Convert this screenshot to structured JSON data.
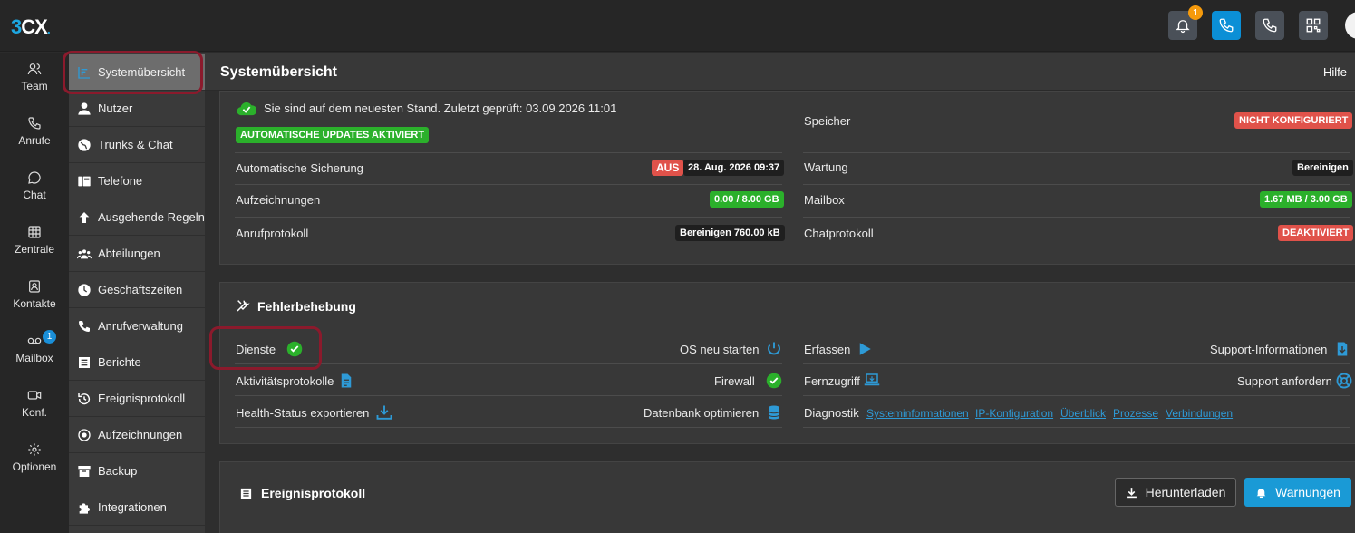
{
  "app": {
    "logo_a": "3",
    "logo_b": "CX",
    "logo_dot": "."
  },
  "topbar": {
    "notification_count": "1"
  },
  "rail": [
    {
      "label": "Team",
      "icon": "team-icon"
    },
    {
      "label": "Anrufe",
      "icon": "phone-icon"
    },
    {
      "label": "Chat",
      "icon": "chat-icon"
    },
    {
      "label": "Zentrale",
      "icon": "grid-icon"
    },
    {
      "label": "Kontakte",
      "icon": "contacts-icon"
    },
    {
      "label": "Mailbox",
      "icon": "voicemail-icon",
      "badge": "1"
    },
    {
      "label": "Konf.",
      "icon": "video-icon"
    },
    {
      "label": "Optionen",
      "icon": "gear-icon"
    }
  ],
  "subnav": [
    {
      "label": "Systemübersicht"
    },
    {
      "label": "Nutzer"
    },
    {
      "label": "Trunks & Chat"
    },
    {
      "label": "Telefone"
    },
    {
      "label": "Ausgehende Regeln"
    },
    {
      "label": "Abteilungen"
    },
    {
      "label": "Geschäftszeiten"
    },
    {
      "label": "Anrufverwaltung"
    },
    {
      "label": "Berichte"
    },
    {
      "label": "Ereignisprotokoll"
    },
    {
      "label": "Aufzeichnungen"
    },
    {
      "label": "Backup"
    },
    {
      "label": "Integrationen"
    }
  ],
  "page": {
    "title": "Systemübersicht",
    "help": "Hilfe"
  },
  "status": {
    "update_msg": "Sie sind auf dem neuesten Stand. Zuletzt geprüft: 03.09.2026 11:01",
    "auto_updates": "AUTOMATISCHE UPDATES AKTIVIERT",
    "backup_label": "Automatische Sicherung",
    "backup_state": "AUS",
    "backup_date": "28. Aug. 2026 09:37",
    "recordings_label": "Aufzeichnungen",
    "recordings_value": "0.00 / 8.00 GB",
    "calllog_label": "Anrufprotokoll",
    "calllog_value": "Bereinigen 760.00 kB",
    "storage_label": "Speicher",
    "storage_value": "NICHT KONFIGURIERT",
    "maintenance_label": "Wartung",
    "maintenance_value": "Bereinigen",
    "mailbox_label": "Mailbox",
    "mailbox_value": "1.67 MB / 3.00 GB",
    "chatlog_label": "Chatprotokoll",
    "chatlog_value": "DEAKTIVIERT"
  },
  "troubleshoot": {
    "title": "Fehlerbehebung",
    "services": "Dienste",
    "os_restart": "OS neu starten",
    "activity_logs": "Aktivitätsprotokolle",
    "firewall": "Firewall",
    "health_export": "Health-Status exportieren",
    "db_optimize": "Datenbank optimieren",
    "capture": "Erfassen",
    "support_info": "Support-Informationen",
    "remote_access": "Fernzugriff",
    "support_request": "Support anfordern",
    "diagnostics": "Diagnostik",
    "diag_links": [
      "Systeminformationen",
      "IP-Konfiguration",
      "Überblick",
      "Prozesse",
      "Verbindungen"
    ]
  },
  "eventlog": {
    "title": "Ereignisprotokoll",
    "download": "Herunterladen",
    "warnings": "Warnungen"
  },
  "colors": {
    "accent": "#1ea7e1",
    "green": "#2bb02b",
    "red": "#e0524a",
    "highlight": "#8b1a2c"
  }
}
